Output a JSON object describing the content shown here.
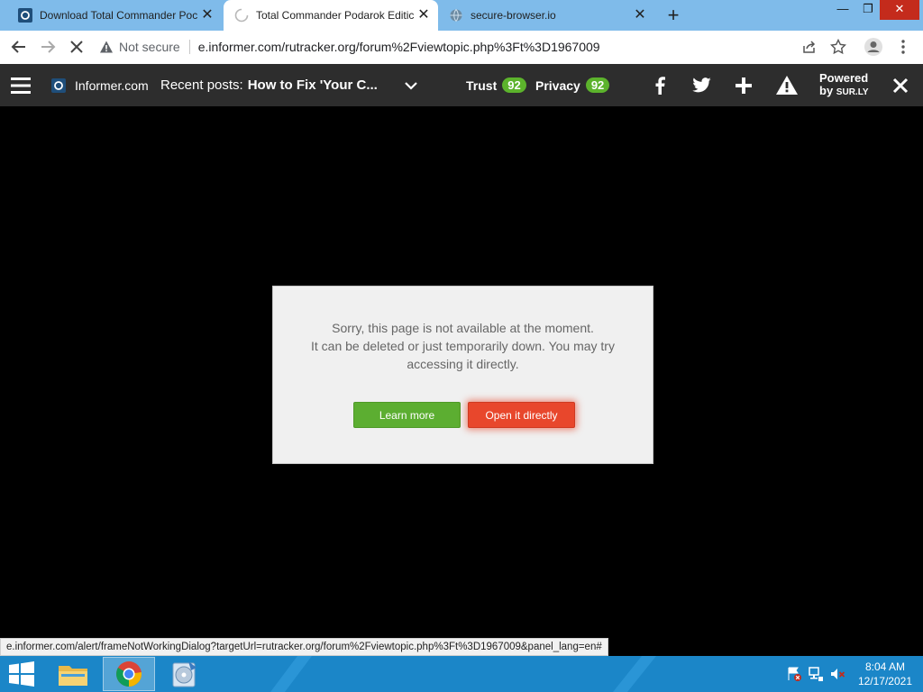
{
  "browser": {
    "tabs": [
      {
        "title": "Download Total Commander Poc",
        "active": false
      },
      {
        "title": "Total Commander Podarok Editic",
        "active": true
      },
      {
        "title": "secure-browser.io",
        "active": false
      }
    ],
    "address": {
      "security": "Not secure",
      "url": "e.informer.com/rutracker.org/forum%2Fviewtopic.php%3Ft%3D1967009"
    }
  },
  "surly": {
    "site": "Informer.com",
    "recent_prefix": "Recent posts:",
    "recent_title": "How to Fix 'Your C...",
    "trust_label": "Trust",
    "trust_value": "92",
    "privacy_label": "Privacy",
    "privacy_value": "92",
    "powered_line1": "Powered",
    "powered_by": "by",
    "powered_brand": "SUR.LY"
  },
  "dialog": {
    "line1": "Sorry, this page is not available at the moment.",
    "line2": "It can be deleted or just temporarily down. You may try",
    "line3": "accessing it directly.",
    "learn_more": "Learn more",
    "open_directly": "Open it directly"
  },
  "status_url": "e.informer.com/alert/frameNotWorkingDialog?targetUrl=rutracker.org/forum%2Fviewtopic.php%3Ft%3D1967009&panel_lang=en#",
  "taskbar": {
    "time": "8:04 AM",
    "date": "12/17/2021"
  },
  "colors": {
    "trust_badge": "#5cb32c",
    "learn_more": "#5cae31",
    "open_directly": "#e8472c",
    "surly_bar": "#2d2d2d",
    "tabstrip": "#7fbbea",
    "taskbar": "#1b86c8"
  }
}
